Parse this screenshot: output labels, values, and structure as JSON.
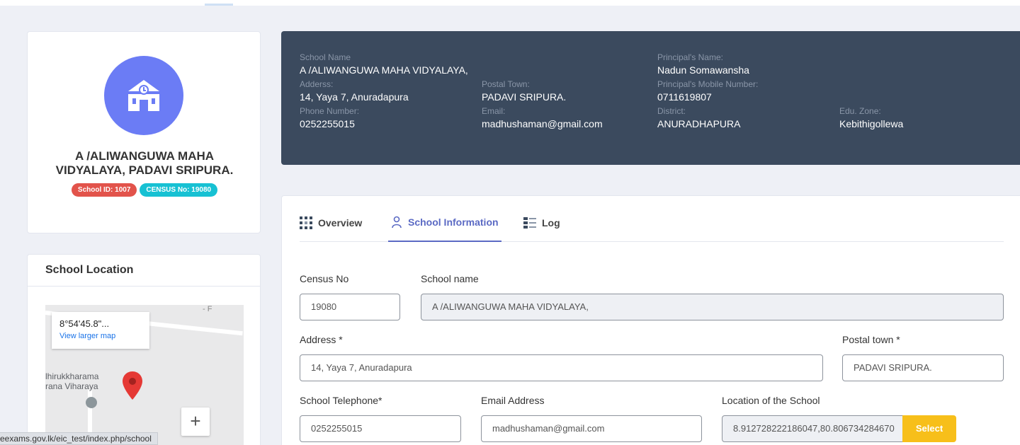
{
  "profile": {
    "school_title_line1": "A /ALIWANGUWA MAHA",
    "school_title_line2": "VIDYALAYA, PADAVI SRIPURA.",
    "school_id_badge": "School ID: 1007",
    "census_badge": "CENSUS No: 19080",
    "avatar_icon": "school-building-icon",
    "avatar_color": "#6b7cf5"
  },
  "location": {
    "title": "School Location",
    "map_coord": "8°54'45.8\"...",
    "map_link": "View larger map",
    "map_place_line1": "lhirukkharama",
    "map_place_line2": "rana Viharaya",
    "road_label": "- F",
    "zoom_in": "+"
  },
  "status_url": "eexams.gov.lk/eic_test/index.php/school",
  "header": {
    "school_name_label": "School Name",
    "school_name": "A /ALIWANGUWA MAHA VIDYALAYA,",
    "address_label": "Adderss:",
    "address": "14, Yaya 7, Anuradapura",
    "postal_town_label": "Postal Town:",
    "postal_town": "PADAVI SRIPURA.",
    "phone_label": "Phone Number:",
    "phone": "0252255015",
    "email_label": "Email:",
    "email": "madhushaman@gmail.com",
    "principal_name_label": "Principal's Name:",
    "principal_name": "Nadun Somawansha",
    "principal_mobile_label": "Principal's Mobile Number:",
    "principal_mobile": "0711619807",
    "district_label": "District:",
    "district": "ANURADHAPURA",
    "edu_zone_label": "Edu. Zone:",
    "edu_zone": "Kebithigollewa",
    "bg_color": "#3b4a5e"
  },
  "tabs": [
    {
      "label": "Overview",
      "icon": "grid-icon"
    },
    {
      "label": "School Information",
      "icon": "user-icon",
      "active": true
    },
    {
      "label": "Log",
      "icon": "list-icon"
    }
  ],
  "form": {
    "census_label": "Census No",
    "census_value": "19080",
    "school_name_label": "School name",
    "school_name_value": "A /ALIWANGUWA MAHA VIDYALAYA,",
    "address_label": "Address *",
    "address_value": "14,  Yaya 7, Anuradapura",
    "postal_label": "Postal town *",
    "postal_value": "PADAVI SRIPURA.",
    "telephone_label": "School Telephone*",
    "telephone_value": "0252255015",
    "email_label": "Email Address",
    "email_value": "madhushaman@gmail.com",
    "location_label": "Location of the School",
    "location_value": "8.912728222186047,80.806734284670",
    "select_button": "Select",
    "accent_color": "#f7bf1a"
  }
}
